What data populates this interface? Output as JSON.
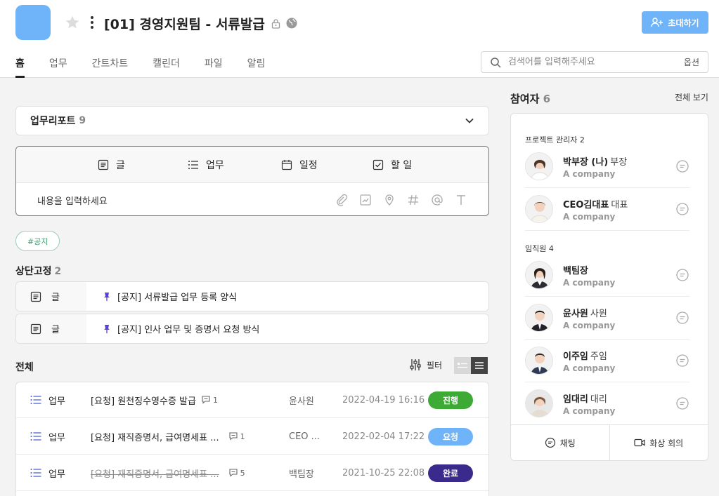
{
  "project": {
    "title": "[01] 경영지원팀 - 서류발급",
    "invite_label": "초대하기"
  },
  "tabs": [
    {
      "label": "홈",
      "active": true
    },
    {
      "label": "업무"
    },
    {
      "label": "간트차트"
    },
    {
      "label": "캘린더"
    },
    {
      "label": "파일"
    },
    {
      "label": "알림"
    }
  ],
  "search": {
    "placeholder": "검색어를 입력해주세요",
    "options_label": "옵션"
  },
  "report": {
    "title": "업무리포트",
    "count": "9"
  },
  "composer": {
    "tabs": [
      "글",
      "업무",
      "일정",
      "할 일"
    ],
    "placeholder": "내용을 입력하세요"
  },
  "hashtag": "#공지",
  "pinned": {
    "title": "상단고정",
    "count": "2",
    "items": [
      {
        "type": "글",
        "title": "[공지] 서류발급 업무 등록 양식"
      },
      {
        "type": "글",
        "title": "[공지] 인사 업무 및 증명서 요청 방식"
      }
    ]
  },
  "all": {
    "title": "전체",
    "filter_label": "필터",
    "rows": [
      {
        "type": "업무",
        "title": "[요청] 원천징수영수증 발급",
        "comments": "1",
        "author": "윤사원",
        "date": "2022-04-19 16:16",
        "status": "진행",
        "status_color": "#3daa35",
        "done": false
      },
      {
        "type": "업무",
        "title": "[요청] 재직증명서, 급여명세표 ...",
        "comments": "1",
        "author": "CEO ...",
        "date": "2022-02-04 17:22",
        "status": "요청",
        "status_color": "#6fb4f9",
        "done": false
      },
      {
        "type": "업무",
        "title": "[요청] 재직증명서, 급여명세표 ...",
        "comments": "5",
        "author": "백팀장",
        "date": "2021-10-25 22:08",
        "status": "완료",
        "status_color": "#3a2a8c",
        "done": true
      }
    ]
  },
  "members": {
    "title": "참여자",
    "count": "6",
    "view_all": "전체 보기",
    "groups": [
      {
        "label": "프로젝트 관리자",
        "count": "2",
        "people": [
          {
            "name": "박부장 (나)",
            "position": "부장",
            "company": "A company"
          },
          {
            "name": "CEO김대표",
            "position": "대표",
            "company": "A company"
          }
        ]
      },
      {
        "label": "임직원",
        "count": "4",
        "people": [
          {
            "name": "백팀장",
            "position": "",
            "company": "A company"
          },
          {
            "name": "윤사원",
            "position": "사원",
            "company": "A company"
          },
          {
            "name": "이주임",
            "position": "주임",
            "company": "A company"
          },
          {
            "name": "임대리",
            "position": "대리",
            "company": "A company"
          }
        ]
      }
    ],
    "chat_label": "채팅",
    "video_label": "화상 회의"
  },
  "colors": {
    "accent": "#6fb4f9",
    "in_progress": "#3daa35",
    "requested": "#6fb4f9",
    "done": "#3a2a8c",
    "pin": "#5b3fd6",
    "task_icon": "#4b5fd1"
  }
}
